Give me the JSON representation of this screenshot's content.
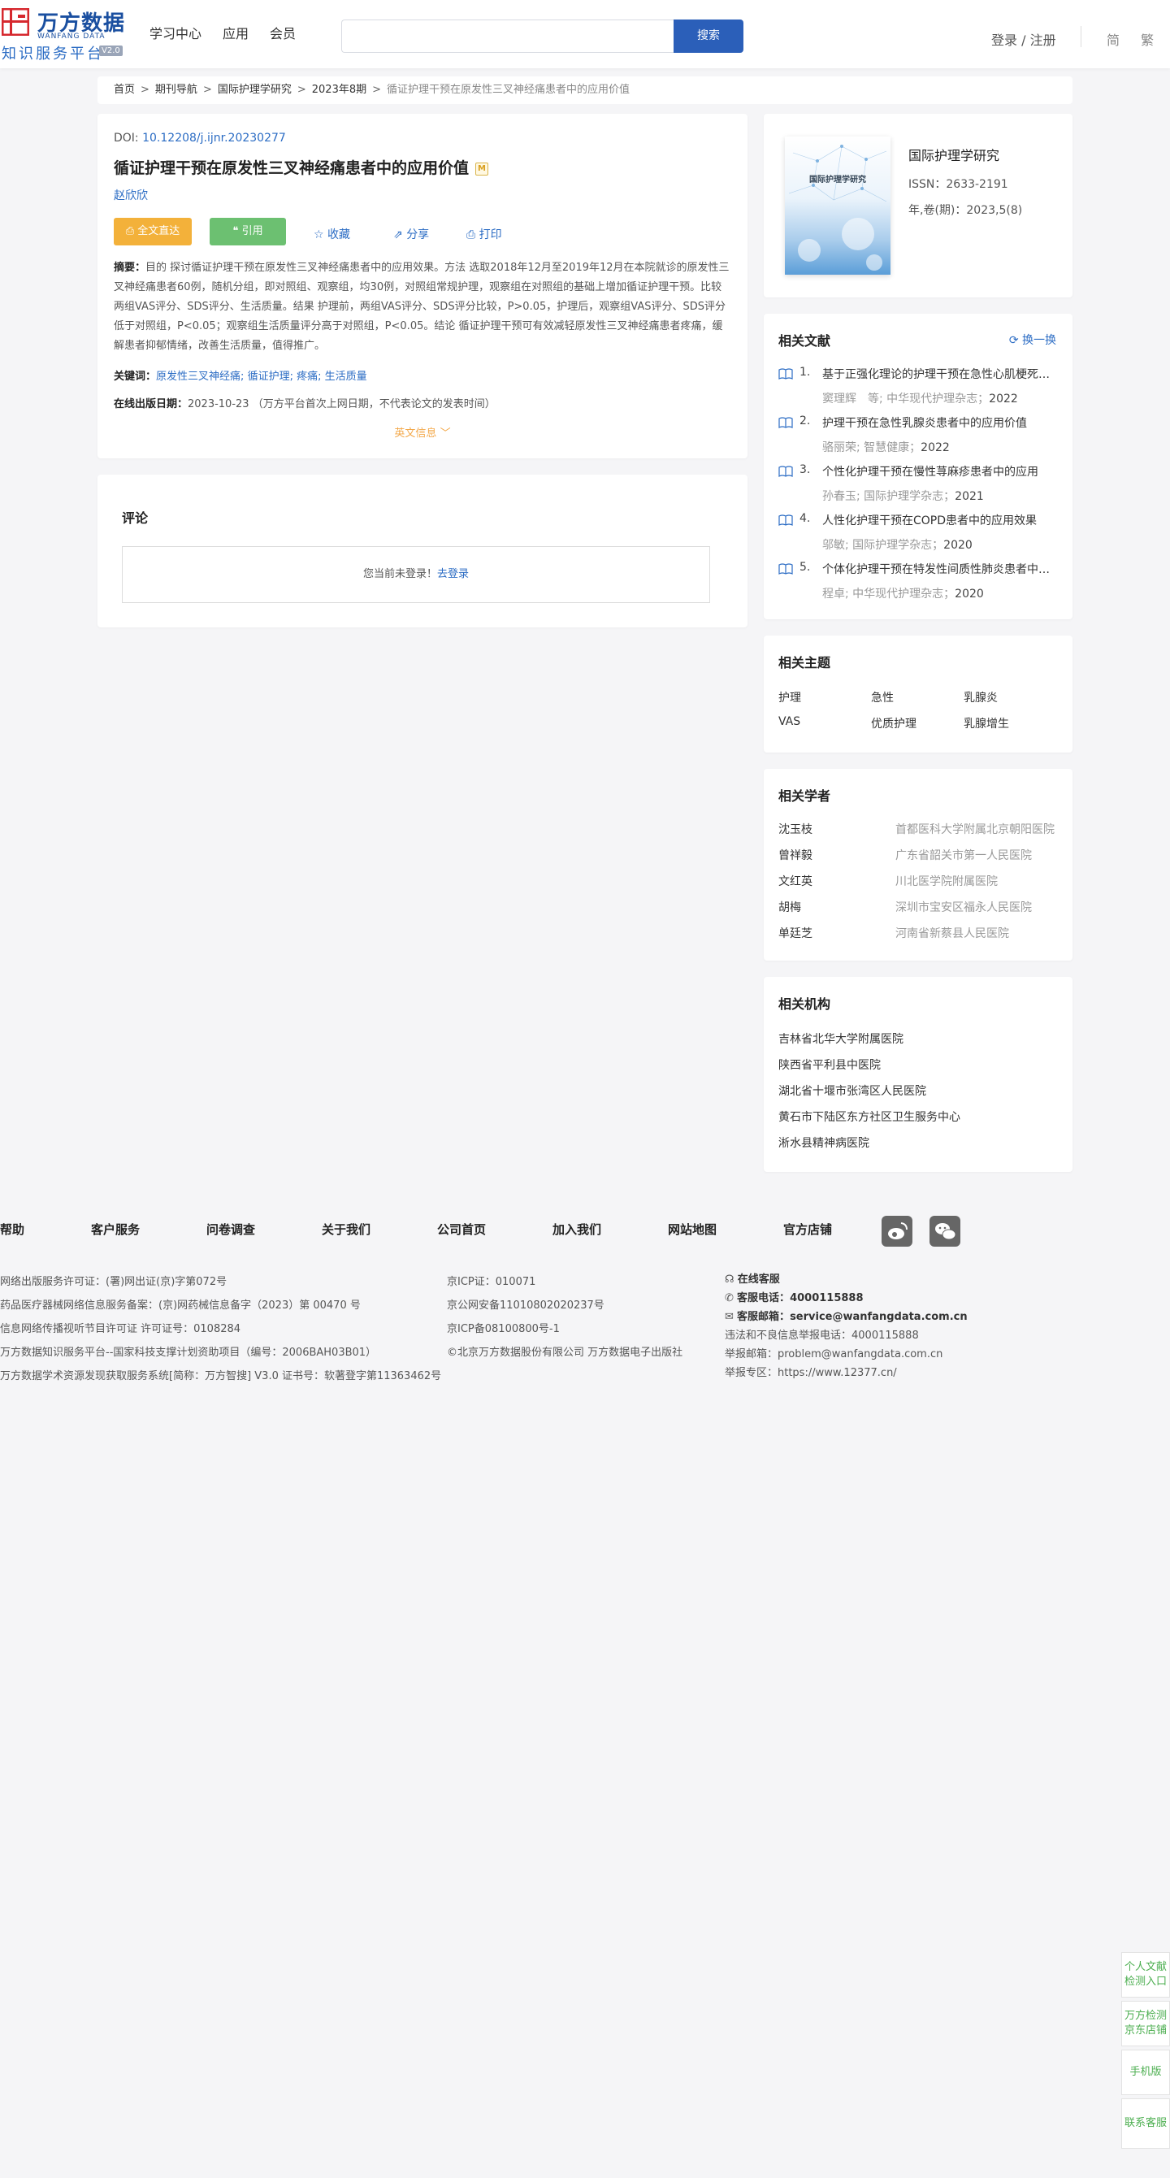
{
  "header": {
    "logo_cn": "万方数据",
    "logo_en": "WANFANG DATA",
    "logo_sub": "知识服务平台",
    "logo_version": "V2.0",
    "nav": [
      "学习中心",
      "应用",
      "会员"
    ],
    "search_button": "搜索",
    "search_placeholder": "",
    "login": "登录 / 注册",
    "lang_simplified": "简",
    "lang_traditional": "繁"
  },
  "breadcrumb": {
    "items": [
      "首页",
      "期刊导航",
      "国际护理学研究",
      "2023年8期"
    ],
    "separator": ">",
    "current": "循证护理干预在原发性三叉神经痛患者中的应用价值"
  },
  "article": {
    "doi_label": "DOI:",
    "doi": "10.12208/j.ijnr.20230277",
    "title": "循证护理干预在原发性三叉神经痛患者中的应用价值",
    "title_badge": "M",
    "author": "赵欣欣",
    "btn_fulltext": "全文直达",
    "btn_cite": "引用",
    "btn_collect": "收藏",
    "btn_share": "分享",
    "btn_print": "打印",
    "abstract_label": "摘要：",
    "abstract": "目的 探讨循证护理干预在原发性三叉神经痛患者中的应用效果。方法 选取2018年12月至2019年12月在本院就诊的原发性三叉神经痛患者60例，随机分组，即对照组、观察组，均30例，对照组常规护理，观察组在对照组的基础上增加循证护理干预。比较两组VAS评分、SDS评分、生活质量。结果 护理前，两组VAS评分、SDS评分比较，P>0.05，护理后，观察组VAS评分、SDS评分低于对照组，P<0.05；观察组生活质量评分高于对照组，P<0.05。结论 循证护理干预可有效减轻原发性三叉神经痛患者疼痛，缓解患者抑郁情绪，改善生活质量，值得推广。",
    "keywords_label": "关键词：",
    "keywords": [
      "原发性三叉神经痛",
      "循证护理",
      "疼痛",
      "生活质量"
    ],
    "keyword_sep": ";",
    "pubdate_label": "在线出版日期：",
    "pubdate": "2023-10-23",
    "pubdate_note": "（万方平台首次上网日期，不代表论文的发表时间）",
    "english_info": "英文信息"
  },
  "comments": {
    "title": "评论",
    "not_logged": "您当前未登录！",
    "login_link": "去登录"
  },
  "journal": {
    "cover_title": "国际护理学研究",
    "name": "国际护理学研究",
    "issn": "ISSN：2633-2191",
    "year": "年,卷(期)：2023,5(8)"
  },
  "related_docs": {
    "title": "相关文献",
    "refresh": "换一换",
    "items": [
      {
        "num": "1.",
        "title": "基于正强化理论的护理干预在急性心肌梗死患者中的应用",
        "authors": "窦理辉　等;",
        "journal": "中华现代护理杂志；",
        "year": "2022"
      },
      {
        "num": "2.",
        "title": "护理干预在急性乳腺炎患者中的应用价值",
        "authors": "骆丽荣;",
        "journal": "智慧健康；",
        "year": "2022"
      },
      {
        "num": "3.",
        "title": "个性化护理干预在慢性荨麻疹患者中的应用",
        "authors": "孙春玉;",
        "journal": "国际护理学杂志；",
        "year": "2021"
      },
      {
        "num": "4.",
        "title": "人性化护理干预在COPD患者中的应用效果",
        "authors": "邬敏;",
        "journal": "国际护理学杂志；",
        "year": "2020"
      },
      {
        "num": "5.",
        "title": "个体化护理干预在特发性间质性肺炎患者中的应用",
        "authors": "程卓;",
        "journal": "中华现代护理杂志；",
        "year": "2020"
      }
    ]
  },
  "related_topics": {
    "title": "相关主题",
    "items": [
      "护理",
      "急性",
      "乳腺炎",
      "VAS",
      "优质护理",
      "乳腺增生"
    ]
  },
  "related_scholars": {
    "title": "相关学者",
    "items": [
      {
        "name": "沈玉枝",
        "inst": "首都医科大学附属北京朝阳医院"
      },
      {
        "name": "曾祥毅",
        "inst": "广东省韶关市第一人民医院"
      },
      {
        "name": "文红英",
        "inst": "川北医学院附属医院"
      },
      {
        "name": "胡梅",
        "inst": "深圳市宝安区福永人民医院"
      },
      {
        "name": "单廷芝",
        "inst": "河南省新蔡县人民医院"
      }
    ]
  },
  "related_orgs": {
    "title": "相关机构",
    "items": [
      "吉林省北华大学附属医院",
      "陕西省平利县中医院",
      "湖北省十堰市张湾区人民医院",
      "黄石市下陆区东方社区卫生服务中心",
      "淅水县精神病医院"
    ]
  },
  "footer": {
    "nav": [
      "帮助",
      "客户服务",
      "问卷调查",
      "关于我们",
      "公司首页",
      "加入我们",
      "网站地图",
      "官方店铺"
    ],
    "col1": [
      "网络出版服务许可证：(署)网出证(京)字第072号",
      "药品医疗器械网络信息服务备案：(京)网药械信息备字（2023）第 00470 号",
      "信息网络传播视听节目许可证 许可证号：0108284",
      "万方数据知识服务平台--国家科技支撑计划资助项目（编号：2006BAH03B01）",
      "万方数据学术资源发现获取服务系统[简称：万方智搜] V3.0 证书号：软著登字第11363462号"
    ],
    "col2": [
      "京ICP证：010071",
      "京公网安备11010802020237号",
      "京ICP备08100800号-1",
      "©北京万方数据股份有限公司 万方数据电子出版社"
    ],
    "online_service": "在线客服",
    "phone_label": "客服电话：",
    "phone": "4000115888",
    "email_label": "客服邮箱：",
    "email": "service@wanfangdata.com.cn",
    "report_phone": "违法和不良信息举报电话：4000115888",
    "report_email": "举报邮箱：problem@wanfangdata.com.cn",
    "report_zone": "举报专区：https://www.12377.cn/"
  },
  "side_float": {
    "b1": "个人文献检测入口",
    "b2": "万方检测京东店铺",
    "b3": "手机版",
    "b4": "联系客服"
  }
}
